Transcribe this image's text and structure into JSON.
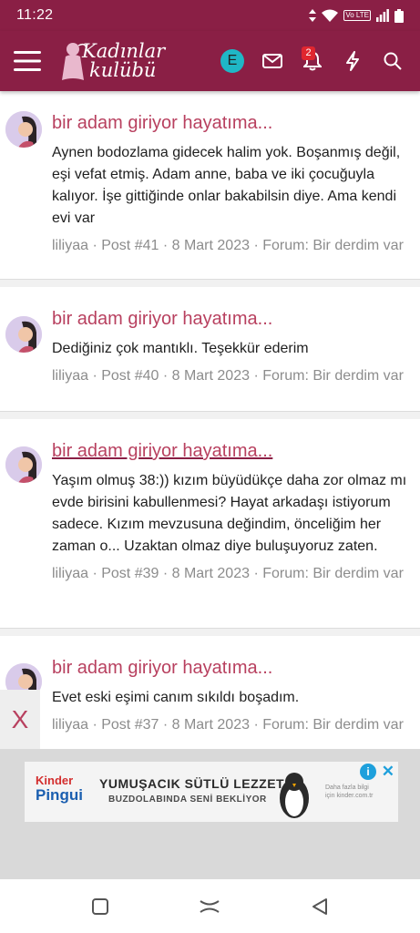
{
  "status_bar": {
    "time": "11:22",
    "volte_label": "Vo LTE"
  },
  "header": {
    "logo_line1": "Kadınlar",
    "logo_line2": "kulübü",
    "user_avatar_letter": "E",
    "notification_count": "2",
    "colors": {
      "brand": "#8a1f45",
      "avatar": "#1fb7c6",
      "badge": "#e0262f"
    },
    "icons": [
      "menu-icon",
      "envelope-icon",
      "bell-icon",
      "lightning-icon",
      "search-icon"
    ]
  },
  "posts": [
    {
      "title": "bir adam giriyor hayatıma...",
      "body": "Aynen bodozlama gidecek halim yok. Boşanmış değil, eşi vefat etmiş. Adam anne, baba ve iki çocuğuyla kalıyor. İşe gittiğinde onlar bakabilsin diye. Ama kendi evi var",
      "meta": "liliyaa · Post #41 · 8 Mart 2023 · Forum: Bir derdim var"
    },
    {
      "title": "bir adam giriyor hayatıma...",
      "body": "Dediğiniz çok mantıklı. Teşekkür ederim",
      "meta": "liliyaa · Post #40 · 8 Mart 2023 · Forum: Bir derdim var"
    },
    {
      "title": "bir adam giriyor hayatıma...",
      "body": "Yaşım olmuş 38:)) kızım büyüdükçe daha zor olmaz mı evde birisini kabullenmesi? Hayat arkadaşı istiyorum sadece. Kızım mevzusuna değindim, önceliğim her zaman o... Uzaktan olmaz diye buluşuyoruz zaten.",
      "meta": "liliyaa · Post #39 · 8 Mart 2023 · Forum: Bir derdim var"
    },
    {
      "title": "bir adam giriyor hayatıma...",
      "body": "Evet eski eşimi canım sıkıldı boşadım.",
      "meta": "liliyaa · Post #37 · 8 Mart 2023 · Forum: Bir derdim var"
    }
  ],
  "ad": {
    "close_label": "X",
    "brand_line1": "Kinder",
    "brand_line2": "Pingui",
    "headline": "YUMUŞACIK SÜTLÜ LEZZET!",
    "subline": "BUZDOLABINDA SENİ BEKLİYOR",
    "note": "Daha fazla bilgi için kinder.com.tr",
    "info_label": "i",
    "dismiss_label": "✕"
  },
  "nav_bar": {
    "icons": [
      "recents-icon",
      "home-icon",
      "back-icon"
    ]
  }
}
